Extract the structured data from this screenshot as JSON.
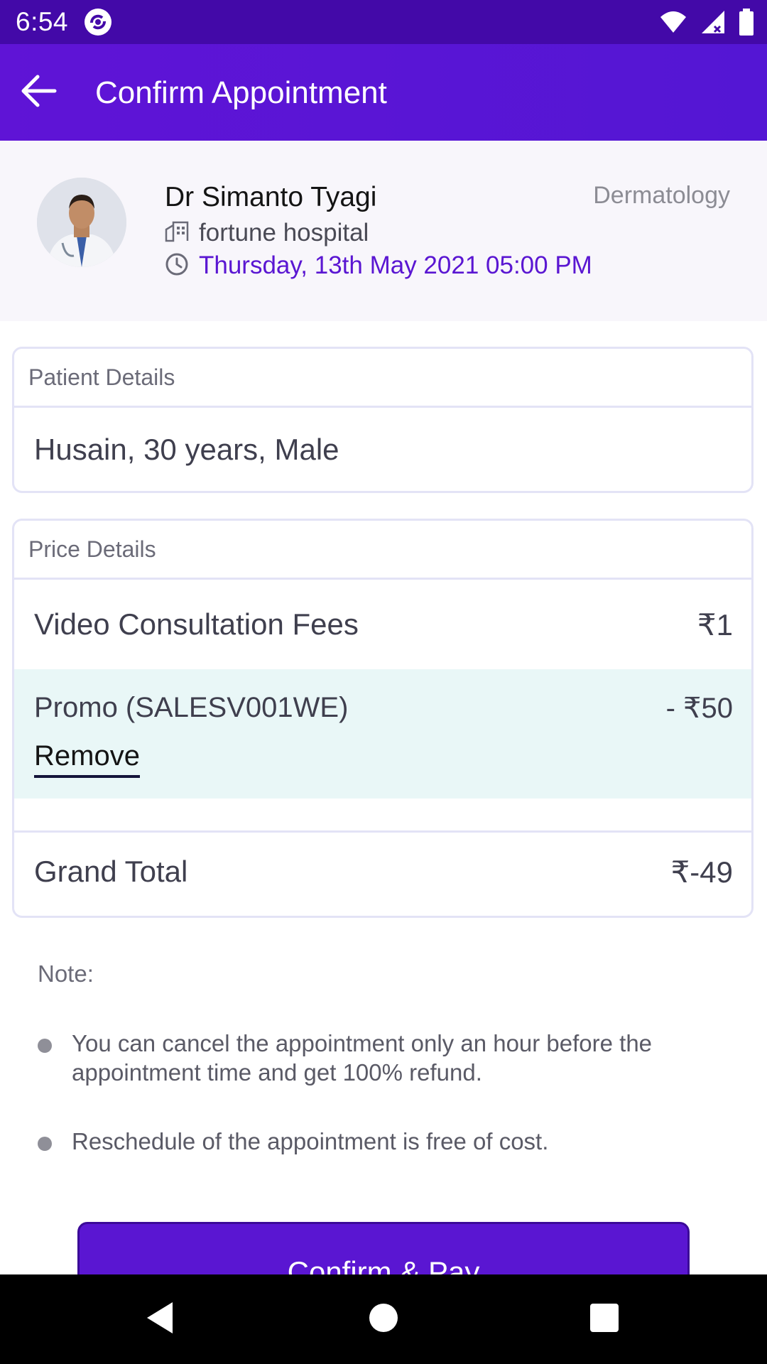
{
  "status_bar": {
    "time": "6:54",
    "icons": [
      "sync-app-icon",
      "wifi-icon",
      "signal-icon",
      "battery-icon"
    ]
  },
  "app_bar": {
    "title": "Confirm Appointment",
    "back_icon": "arrow-left-icon"
  },
  "doctor": {
    "name": "Dr Simanto Tyagi",
    "specialty": "Dermatology",
    "hospital": "fortune hospital",
    "datetime": "Thursday, 13th May 2021 05:00 PM"
  },
  "patient_details": {
    "header": "Patient Details",
    "summary": "Husain, 30 years, Male"
  },
  "price_details": {
    "header": "Price Details",
    "fee_label": "Video Consultation Fees",
    "fee_value": "₹1",
    "promo_label": "Promo (SALESV001WE)",
    "promo_value": "- ₹50",
    "remove_label": "Remove",
    "total_label": "Grand Total",
    "total_value": "₹-49"
  },
  "notes": {
    "title": "Note:",
    "items": [
      "You can cancel the appointment only an hour before the appointment time and get 100% refund.",
      "Reschedule of the appointment is free of cost."
    ]
  },
  "confirm_button": {
    "label": "Confirm & Pay"
  },
  "colors": {
    "status_bar": "#4309A8",
    "app_bar": "#5A16D2",
    "accent": "#5A16D2",
    "promo_bg": "#E9F7F7",
    "card_border": "#E3E3F6"
  }
}
